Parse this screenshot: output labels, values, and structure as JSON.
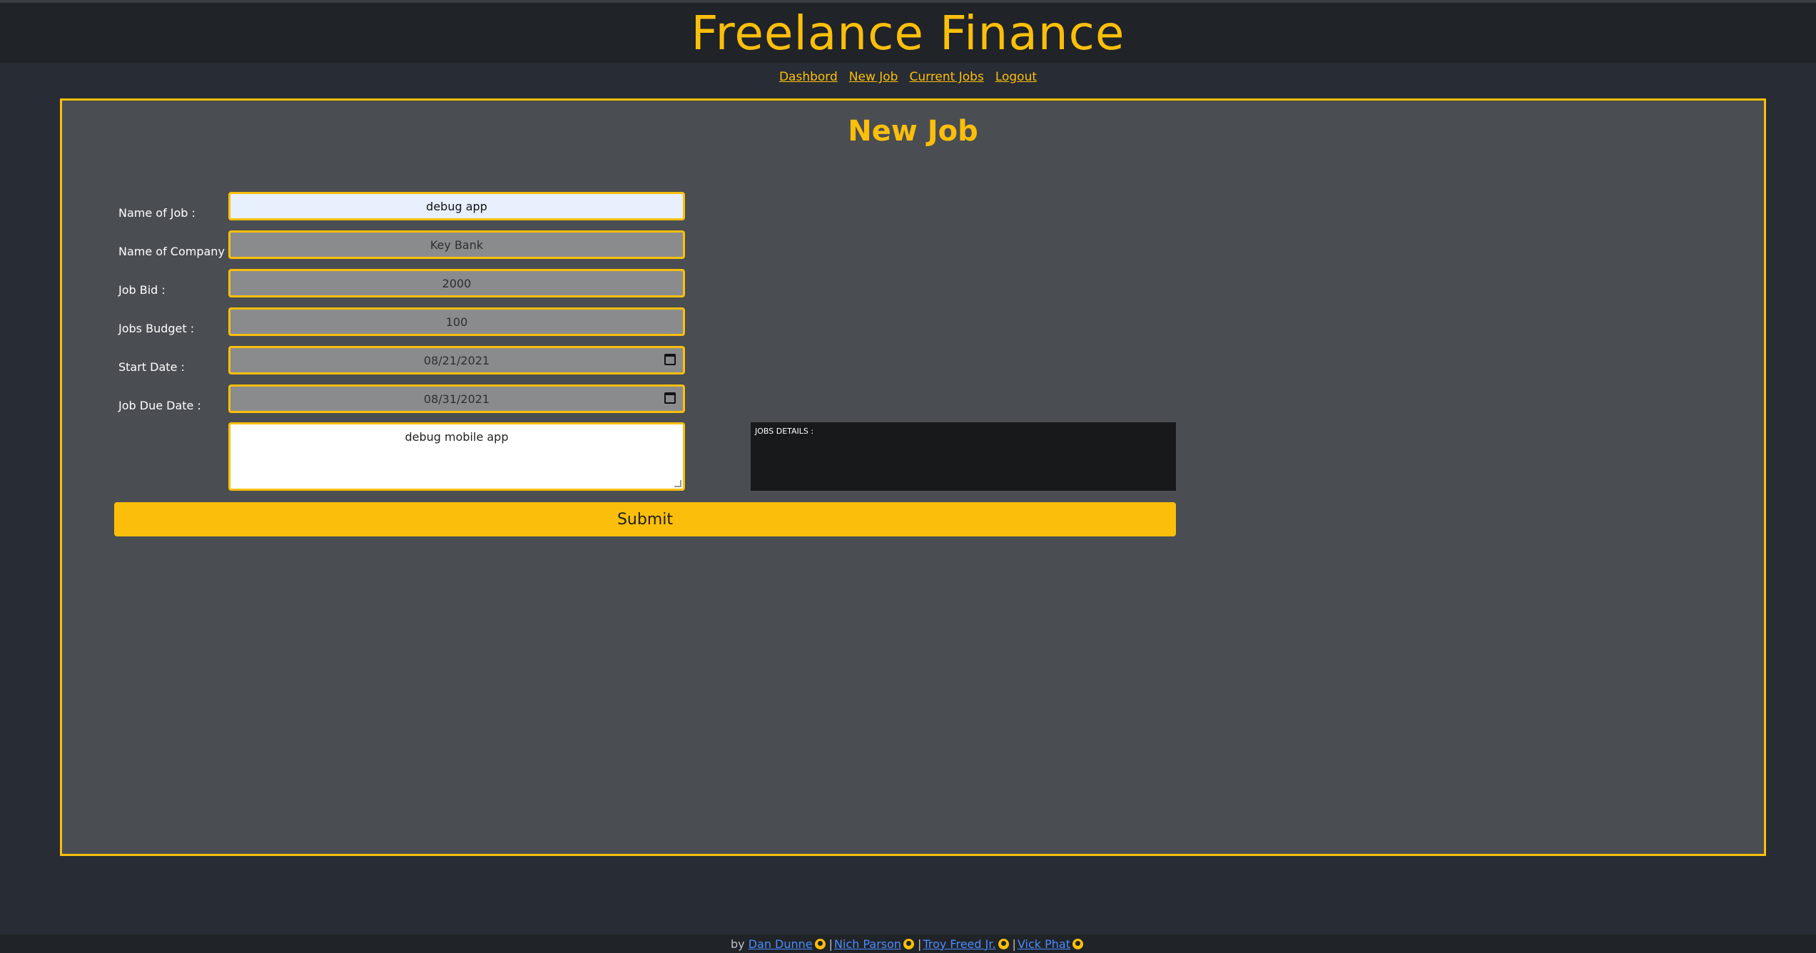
{
  "app": {
    "title": "Freelance Finance"
  },
  "nav": {
    "items": [
      "Dashbord",
      "New Job",
      "Current Jobs",
      "Logout"
    ]
  },
  "page": {
    "title": "New Job"
  },
  "form": {
    "name_of_job": {
      "label": "Name of Job :",
      "value": "debug app"
    },
    "name_of_company": {
      "label": "Name of Company :",
      "value": "Key Bank"
    },
    "job_bid": {
      "label": "Job Bid :",
      "value": "2000"
    },
    "jobs_budget": {
      "label": "Jobs Budget :",
      "value": "100"
    },
    "start_date": {
      "label": "Start Date :",
      "value": "08/21/2021"
    },
    "due_date": {
      "label": "Job Due Date :",
      "value": "08/31/2021"
    },
    "description": {
      "value": "debug mobile app"
    },
    "details_heading": "JOBS DETAILS :",
    "submit_label": "Submit"
  },
  "footer": {
    "prefix": "by",
    "authors": [
      "Dan Dunne",
      "Nich Parson",
      "Troy Freed Jr.",
      "Vick Phat"
    ]
  },
  "colors": {
    "accent": "#fbbf0b",
    "panel": "#4a4d52",
    "background": "#282c34"
  },
  "icons": [
    "calendar-icon",
    "github-icon"
  ]
}
